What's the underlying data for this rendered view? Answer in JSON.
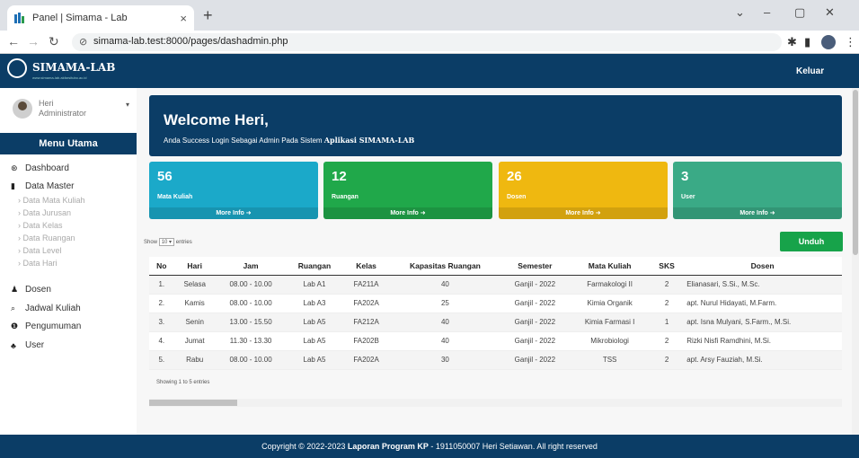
{
  "browser": {
    "tab_title": "Panel | Simama - Lab",
    "tab_close": "×",
    "new_tab": "+",
    "url": "simama-lab.test:8000/pages/dashadmin.php",
    "win_min": "–",
    "win_max": "▢",
    "win_close": "✕",
    "chevron": "⌄"
  },
  "header": {
    "brand": "SIMAMA-LAB",
    "brand_sub": "www.simama-lab.akfarsitubo.ac.id",
    "logout": "Keluar"
  },
  "user": {
    "name": "Heri",
    "role": "Administrator"
  },
  "menu": {
    "title": "Menu Utama",
    "items": [
      {
        "label": "Dashboard",
        "icon": "dashboard-icon"
      },
      {
        "label": "Data Master",
        "icon": "bookmark-icon"
      },
      {
        "label": "Dosen",
        "icon": "user-plus-icon"
      },
      {
        "label": "Jadwal Kuliah",
        "icon": "search-icon"
      },
      {
        "label": "Pengumuman",
        "icon": "info-icon"
      },
      {
        "label": "User",
        "icon": "users-icon"
      }
    ],
    "sub_items": [
      "Data Mata Kuliah",
      "Data Jurusan",
      "Data Kelas",
      "Data Ruangan",
      "Data Level",
      "Data Hari"
    ]
  },
  "welcome": {
    "title": "Welcome Heri,",
    "text": "Anda Success Login Sebagai Admin Pada Sistem",
    "app": "Aplikasi SIMAMA-LAB"
  },
  "cards": [
    {
      "num": "56",
      "label": "Mata Kuliah",
      "more": "More Info",
      "color": "#1ba9c9"
    },
    {
      "num": "12",
      "label": "Ruangan",
      "more": "More Info",
      "color": "#20a84a"
    },
    {
      "num": "26",
      "label": "Dosen",
      "more": "More Info",
      "color": "#efb810"
    },
    {
      "num": "3",
      "label": "User",
      "more": "More Info",
      "color": "#3aaa86"
    }
  ],
  "table": {
    "show_prefix": "Show",
    "show_value": "10",
    "show_suffix": "entries",
    "download": "Unduh",
    "headers": [
      "No",
      "Hari",
      "Jam",
      "Ruangan",
      "Kelas",
      "Kapasitas Ruangan",
      "Semester",
      "Mata Kuliah",
      "SKS",
      "Dosen"
    ],
    "rows": [
      [
        "1.",
        "Selasa",
        "08.00 - 10.00",
        "Lab A1",
        "FA211A",
        "40",
        "Ganjil - 2022",
        "Farmakologi II",
        "2",
        "Elianasari, S.Si., M.Sc."
      ],
      [
        "2.",
        "Kamis",
        "08.00 - 10.00",
        "Lab A3",
        "FA202A",
        "25",
        "Ganjil - 2022",
        "Kimia Organik",
        "2",
        "apt. Nurul Hidayati, M.Farm."
      ],
      [
        "3.",
        "Senin",
        "13.00 - 15.50",
        "Lab A5",
        "FA212A",
        "40",
        "Ganjil - 2022",
        "Kimia Farmasi I",
        "1",
        "apt. Isna Mulyani, S.Farm., M.Si."
      ],
      [
        "4.",
        "Jumat",
        "11.30 - 13.30",
        "Lab A5",
        "FA202B",
        "40",
        "Ganjil - 2022",
        "Mikrobiologi",
        "2",
        "Rizki Nisfi Ramdhini, M.Si."
      ],
      [
        "5.",
        "Rabu",
        "08.00 - 10.00",
        "Lab A5",
        "FA202A",
        "30",
        "Ganjil - 2022",
        "TSS",
        "2",
        "apt. Arsy Fauziah, M.Si."
      ]
    ],
    "showing": "Showing 1 to 5 entries"
  },
  "footer": {
    "copy": "Copyright © 2022-2023",
    "bold": "Laporan Program KP",
    "rest": "- 1911050007 Heri Setiawan. All right reserved"
  }
}
